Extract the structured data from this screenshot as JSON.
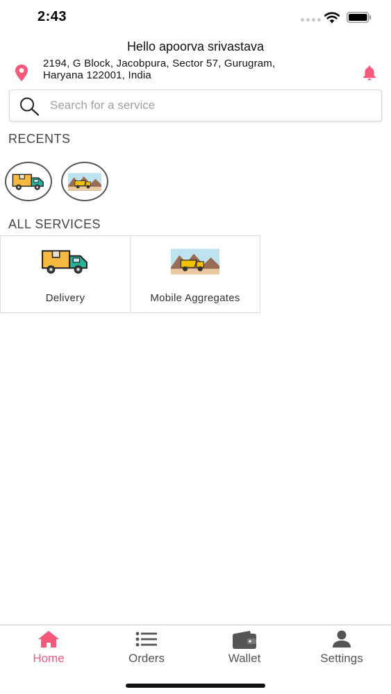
{
  "status_bar": {
    "time": "2:43"
  },
  "header": {
    "greeting": "Hello apoorva srivastava",
    "address_line1": "2194, G Block, Jacobpura, Sector 57, Gurugram,",
    "address_line2": "Haryana 122001, India"
  },
  "search": {
    "placeholder": "Search for a service",
    "value": ""
  },
  "recents": {
    "title": "RECENTS",
    "items": [
      {
        "icon": "delivery-truck-icon"
      },
      {
        "icon": "dump-truck-icon"
      }
    ]
  },
  "all_services": {
    "title": "ALL SERVICES",
    "items": [
      {
        "label": "Delivery",
        "icon": "delivery-truck-icon"
      },
      {
        "label": "Mobile Aggregates",
        "icon": "dump-truck-icon"
      }
    ]
  },
  "bottom_nav": {
    "items": [
      {
        "label": "Home",
        "icon": "home-icon",
        "active": true
      },
      {
        "label": "Orders",
        "icon": "list-icon",
        "active": false
      },
      {
        "label": "Wallet",
        "icon": "wallet-icon",
        "active": false
      },
      {
        "label": "Settings",
        "icon": "person-icon",
        "active": false
      }
    ]
  },
  "colors": {
    "accent": "#f4587a",
    "nav_inactive": "#555555",
    "truck_cargo": "#f5b942",
    "truck_cab": "#26b39a"
  }
}
